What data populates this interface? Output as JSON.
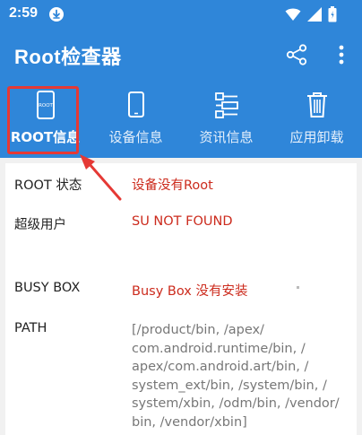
{
  "status_bar": {
    "time": "2:59",
    "icons": [
      "download-icon",
      "wifi-icon",
      "cellular-signal-icon",
      "battery-icon"
    ]
  },
  "app_bar": {
    "title": "Root检查器",
    "actions": [
      "share-icon",
      "more-vert-icon"
    ]
  },
  "tabs": [
    {
      "label": "ROOT信息",
      "icon": "phone-root-icon",
      "icon_text": "ROOT",
      "active": true
    },
    {
      "label": "设备信息",
      "icon": "phone-icon",
      "active": false
    },
    {
      "label": "资讯信息",
      "icon": "info-list-icon",
      "active": false
    },
    {
      "label": "应用卸载",
      "icon": "trash-icon",
      "active": false
    }
  ],
  "rows": [
    {
      "label": "ROOT 状态",
      "value": "设备没有Root"
    },
    {
      "label": "超级用户",
      "value": "SU NOT FOUND"
    },
    {
      "label": "BUSY BOX",
      "value": "Busy Box 没有安装"
    },
    {
      "label": "PATH",
      "value_lines": [
        "[/product/bin, /apex/",
        "com.android.runtime/bin, /",
        "apex/com.android.art/bin, /",
        "system_ext/bin, /system/bin, /",
        "system/xbin, /odm/bin, /vendor/",
        "bin, /vendor/xbin]"
      ]
    }
  ],
  "colors": {
    "primary": "#2f86d9",
    "value_red": "#cc2b1d",
    "highlight_red": "#e53935",
    "path_gray": "#777777"
  }
}
